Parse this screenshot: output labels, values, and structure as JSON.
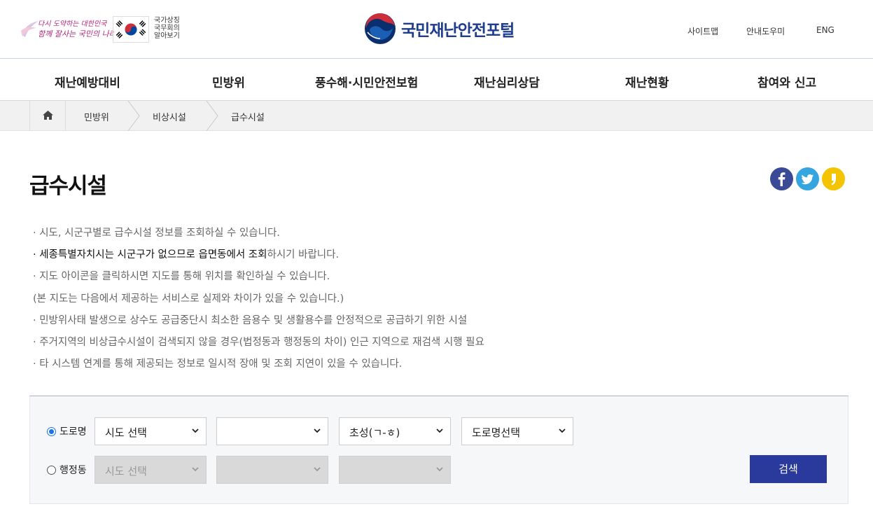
{
  "header": {
    "slogan_line1": "다시 도약하는 대한민국",
    "slogan_line2": "함께 잘사는 국민의 나라",
    "national_symbol_label": [
      "국가상징",
      "국무회의",
      "알아보기"
    ],
    "site_name": "국민재난안전포털",
    "util_links": [
      "사이트맵",
      "안내도우미",
      "ENG"
    ],
    "brand_color": "#1f3d8c"
  },
  "gnb": {
    "items": [
      "재난예방대비",
      "민방위",
      "풍수해·시민안전보험",
      "재난심리상담",
      "재난현황",
      "참여와 신고"
    ]
  },
  "breadcrumb": {
    "home_icon": "home-icon",
    "items": [
      "민방위",
      "비상시설",
      "급수시설"
    ]
  },
  "page": {
    "title": "급수시설",
    "share_icons": [
      "facebook-icon",
      "twitter-icon",
      "kakaostory-icon"
    ]
  },
  "notes": [
    {
      "text": "· 시도, 시군구별로 급수시설 정보를 조회하실 수 있습니다."
    },
    {
      "strong": "· 세종특별자치시는 시군구가 없으므로 읍면동에서 조회",
      "text": "하시기 바랍니다."
    },
    {
      "text": "· 지도 아이콘을 클릭하시면 지도를 통해 위치를 확인하실 수 있습니다."
    },
    {
      "text": "(본 지도는 다음에서 제공하는 서비스로 실제와 차이가 있을 수 있습니다.)"
    },
    {
      "text": "· 민방위사태 발생으로 상수도 공급중단시 최소한 음용수 및 생활용수를 안정적으로 공급하기 위한 시설"
    },
    {
      "text": "· 주거지역의 비상급수시설이 검색되지 않을 경우(법정동과 행정동의 차이) 인근 지역으로 재검색 시행 필요"
    },
    {
      "text": "· 타 시스템 연계를 통해 제공되는 정보로 일시적 장애 및 조회 지연이 있을 수 있습니다."
    }
  ],
  "search": {
    "road": {
      "label": "도로명",
      "selected": true,
      "selects": [
        "시도 선택",
        "",
        "초성(ㄱ-ㅎ)",
        "도로명선택"
      ]
    },
    "admin": {
      "label": "행정동",
      "selected": false,
      "selects": [
        "시도 선택",
        "",
        ""
      ]
    },
    "button": "검색",
    "button_color": "#2a3a9c"
  }
}
